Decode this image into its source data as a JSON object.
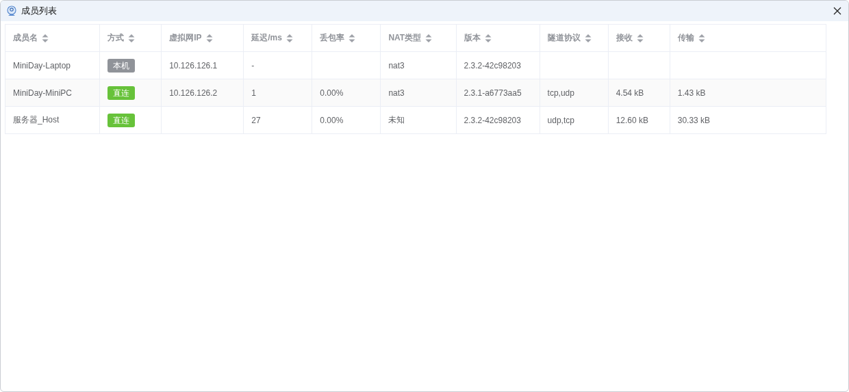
{
  "window": {
    "title": "成员列表"
  },
  "table": {
    "columns": [
      "成员名",
      "方式",
      "虚拟网IP",
      "延迟/ms",
      "丢包率",
      "NAT类型",
      "版本",
      "隧道协议",
      "接收",
      "传输"
    ],
    "rows": [
      {
        "cells": [
          "MiniDay-Laptop",
          {
            "label": "本机",
            "kind": "local"
          },
          "10.126.126.1",
          "-",
          "",
          "nat3",
          "2.3.2-42c98203",
          "",
          "",
          ""
        ]
      },
      {
        "cells": [
          "MiniDay-MiniPC",
          {
            "label": "直连",
            "kind": "direct"
          },
          "10.126.126.2",
          "1",
          "0.00%",
          "nat3",
          "2.3.1-a6773aa5",
          "tcp,udp",
          "4.54 kB",
          "1.43 kB"
        ]
      },
      {
        "cells": [
          "服务器_Host",
          {
            "label": "直连",
            "kind": "direct"
          },
          "",
          "27",
          "0.00%",
          "未知",
          "2.3.2-42c98203",
          "udp,tcp",
          "12.60 kB",
          "30.33 kB"
        ]
      }
    ]
  }
}
